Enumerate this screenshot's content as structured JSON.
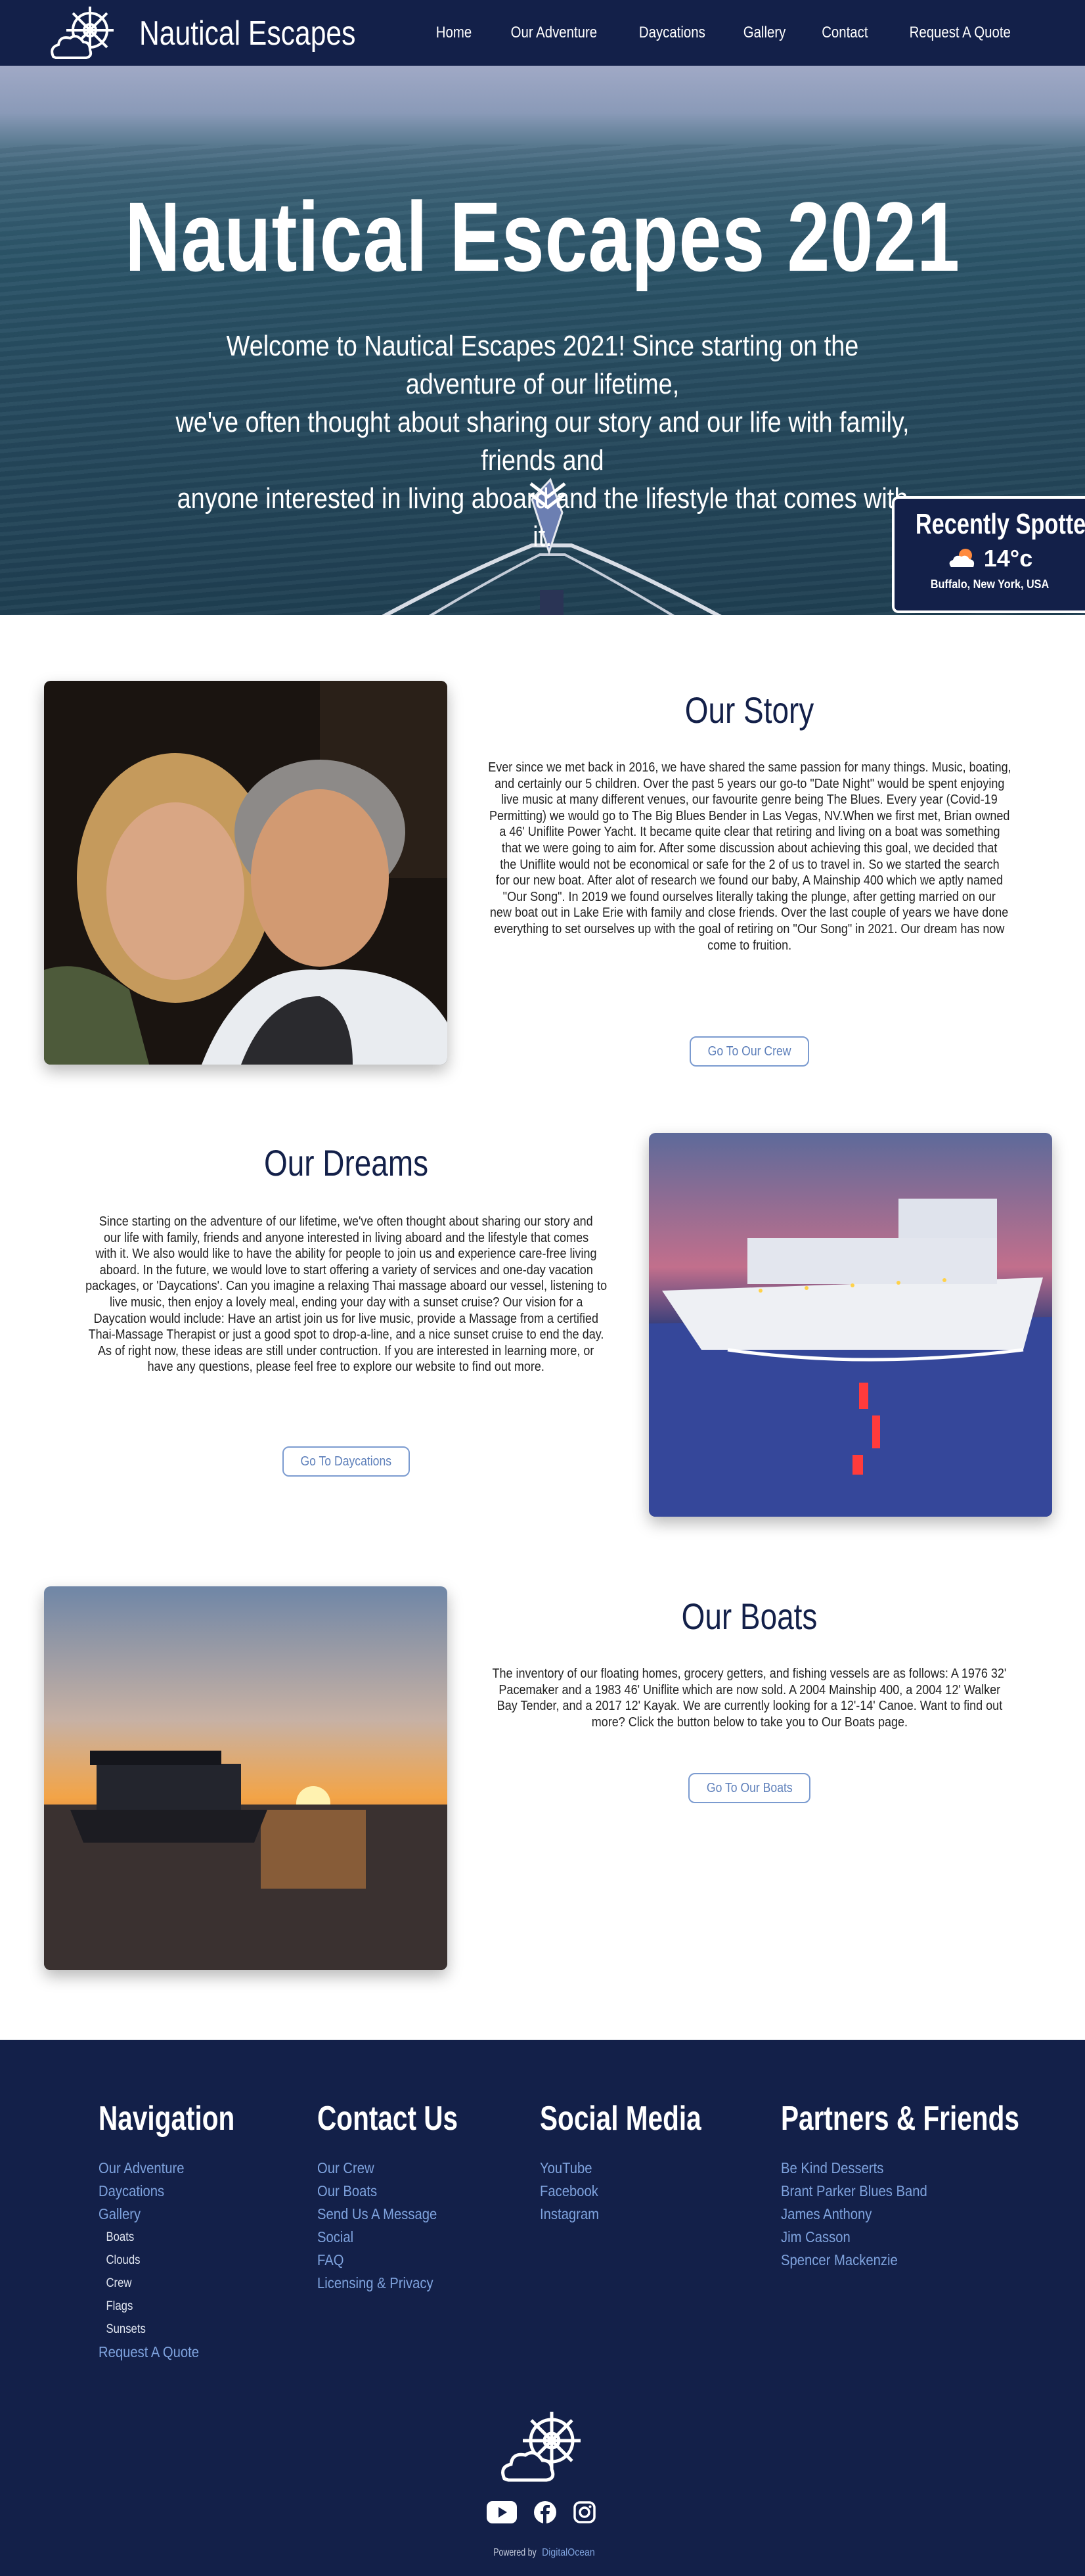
{
  "header": {
    "brand": "Nautical Escapes",
    "logo_icon": "ship-wheel-cloud-icon",
    "nav": [
      "Home",
      "Our Adventure",
      "Daycations",
      "Gallery",
      "Contact",
      "Request A Quote"
    ]
  },
  "hero": {
    "title": "Nautical Escapes 2021",
    "lines": [
      "Welcome to Nautical Escapes 2021! Since starting on the adventure of our lifetime,",
      "we've often thought about sharing our story and our life with family, friends and",
      "anyone interested in living aboard and the lifestyle that comes with it."
    ],
    "scroll_icon": "double-chevron-down-icon"
  },
  "spotted": {
    "title": "Recently Spotted",
    "weather_icon": "sun-cloud-icon",
    "temp": "14°c",
    "location": "Buffalo, New York, USA"
  },
  "story": {
    "title": "Our Story",
    "lines": [
      "Ever since we met back in 2016, we have shared the same passion for many things. Music, boating,",
      "and certainly our 5 children. Over the past 5 years our go-to \"Date Night\" would be spent enjoying",
      "live music at many different venues, our favourite genre being The Blues. Every year (Covid-19",
      "Permitting) we would go to The Big Blues Bender in Las Vegas, NV.When we first met, Brian owned",
      "a 46' Uniflite Power Yacht. It became quite clear that retiring and living on a boat was something",
      "that we were going to aim for. After some discussion about achieving this goal, we decided that",
      "the Uniflite would not be economical or safe for the 2 of us to travel in. So we started the search",
      "for our new boat. After alot of research we found our baby, A Mainship 400 which we aptly named",
      "\"Our Song\". In 2019 we found ourselves literally taking the plunge, after getting married on our",
      "new boat out in Lake Erie with family and close friends. Over the last couple of years we have done",
      "everything to set ourselves up with the goal of retiring on \"Our Song\" in 2021. Our dream has now",
      "come to fruition."
    ],
    "button": "Go To Our Crew"
  },
  "dreams": {
    "title": "Our Dreams",
    "lines": [
      "Since starting on the adventure of our lifetime, we've often thought about sharing our story and",
      "our life with family, friends and anyone interested in living aboard and the lifestyle that comes",
      "with it. We also would like to have the ability for people to join us and experience care-free living",
      "aboard. In the future, we would love to start offering a variety of services and one-day vacation",
      "packages, or 'Daycations'. Can you imagine a relaxing Thai massage aboard our vessel, listening to",
      "live music, then enjoy a lovely meal, ending your day with a sunset cruise? Our vision for a",
      "Daycation would include: Have an artist join us for live music, provide a Massage from a certified",
      "Thai-Massage Therapist or just a good spot to drop-a-line, and a nice sunset cruise to end the day.",
      "As of right now, these ideas are still under contruction. If you are interested in learning more, or",
      "have any questions, please feel free to explore our website to find out more."
    ],
    "button": "Go To Daycations"
  },
  "boats": {
    "title": "Our Boats",
    "lines": [
      "The inventory of our floating homes, grocery getters, and fishing vessels are as follows: A 1976 32'",
      "Pacemaker and a 1983 46' Uniflite which are now sold. A 2004 Mainship 400, a 2004 12' Walker",
      "Bay Tender, and a 2017 12' Kayak. We are currently looking for a 12'-14' Canoe. Want to find out",
      "more? Click the button below to take you to Our Boats page."
    ],
    "button": "Go To Our Boats"
  },
  "footer": {
    "navigation": {
      "title": "Navigation",
      "items": [
        {
          "label": "Our Adventure",
          "sub": false
        },
        {
          "label": "Daycations",
          "sub": false
        },
        {
          "label": "Gallery",
          "sub": false
        },
        {
          "label": "Boats",
          "sub": true
        },
        {
          "label": "Clouds",
          "sub": true
        },
        {
          "label": "Crew",
          "sub": true
        },
        {
          "label": "Flags",
          "sub": true
        },
        {
          "label": "Sunsets",
          "sub": true
        },
        {
          "label": "Request A Quote",
          "sub": false
        }
      ]
    },
    "contact": {
      "title": "Contact Us",
      "items": [
        "Our Crew",
        "Our Boats",
        "Send Us A Message",
        "Social",
        "FAQ",
        "Licensing & Privacy"
      ]
    },
    "social": {
      "title": "Social Media",
      "items": [
        "YouTube",
        "Facebook",
        "Instagram"
      ],
      "icons": [
        "youtube-icon",
        "facebook-icon",
        "instagram-icon"
      ]
    },
    "partners": {
      "title": "Partners & Friends",
      "items": [
        "Be Kind Desserts",
        "Brant Parker Blues Band",
        "James Anthony",
        "Jim Casson",
        "Spencer Mackenzie"
      ]
    },
    "powered_prefix": "Powered by",
    "powered_link": "DigitalOcean"
  },
  "colors": {
    "navy": "#132049",
    "link": "#7fa3de",
    "button_border": "#7b9bd0"
  }
}
